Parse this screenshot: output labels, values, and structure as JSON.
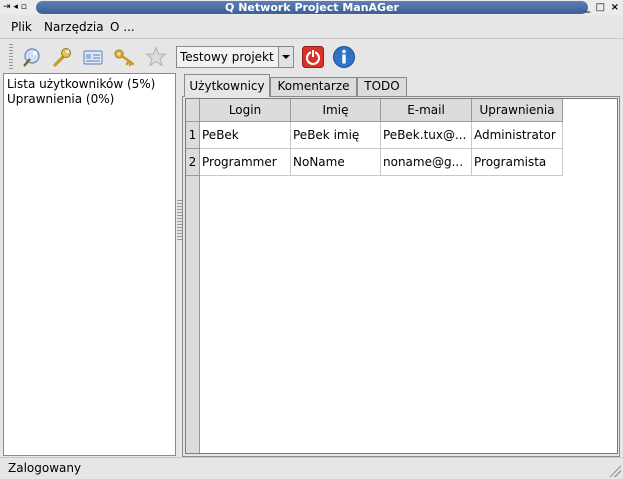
{
  "window": {
    "title": "Q Network Project ManAGer",
    "left_controls": "⇥ ◂ ▫",
    "right_controls": "_ □ ×"
  },
  "menu": {
    "items": [
      "Plik",
      "Narzędzia",
      "O ..."
    ]
  },
  "toolbar": {
    "icons": [
      "wizard-icon",
      "wrench-icon",
      "card-icon",
      "key-icon",
      "star-icon",
      "power-icon",
      "info-icon"
    ],
    "project_select": "Testowy projekt"
  },
  "left_panel": {
    "items": [
      "Lista użytkowników (5%)",
      "Uprawnienia (0%)"
    ]
  },
  "tabs": [
    "Użytkownicy",
    "Komentarze",
    "TODO"
  ],
  "table": {
    "columns": [
      "Login",
      "Imię",
      "E-mail",
      "Uprawnienia"
    ],
    "rows": [
      {
        "num": "1",
        "cells": [
          "PeBek",
          "PeBek imię",
          "PeBek.tux@...",
          "Administrator"
        ]
      },
      {
        "num": "2",
        "cells": [
          "Programmer",
          "NoName",
          "noname@g...",
          "Programista"
        ]
      }
    ]
  },
  "status": {
    "text": "Zalogowany"
  }
}
